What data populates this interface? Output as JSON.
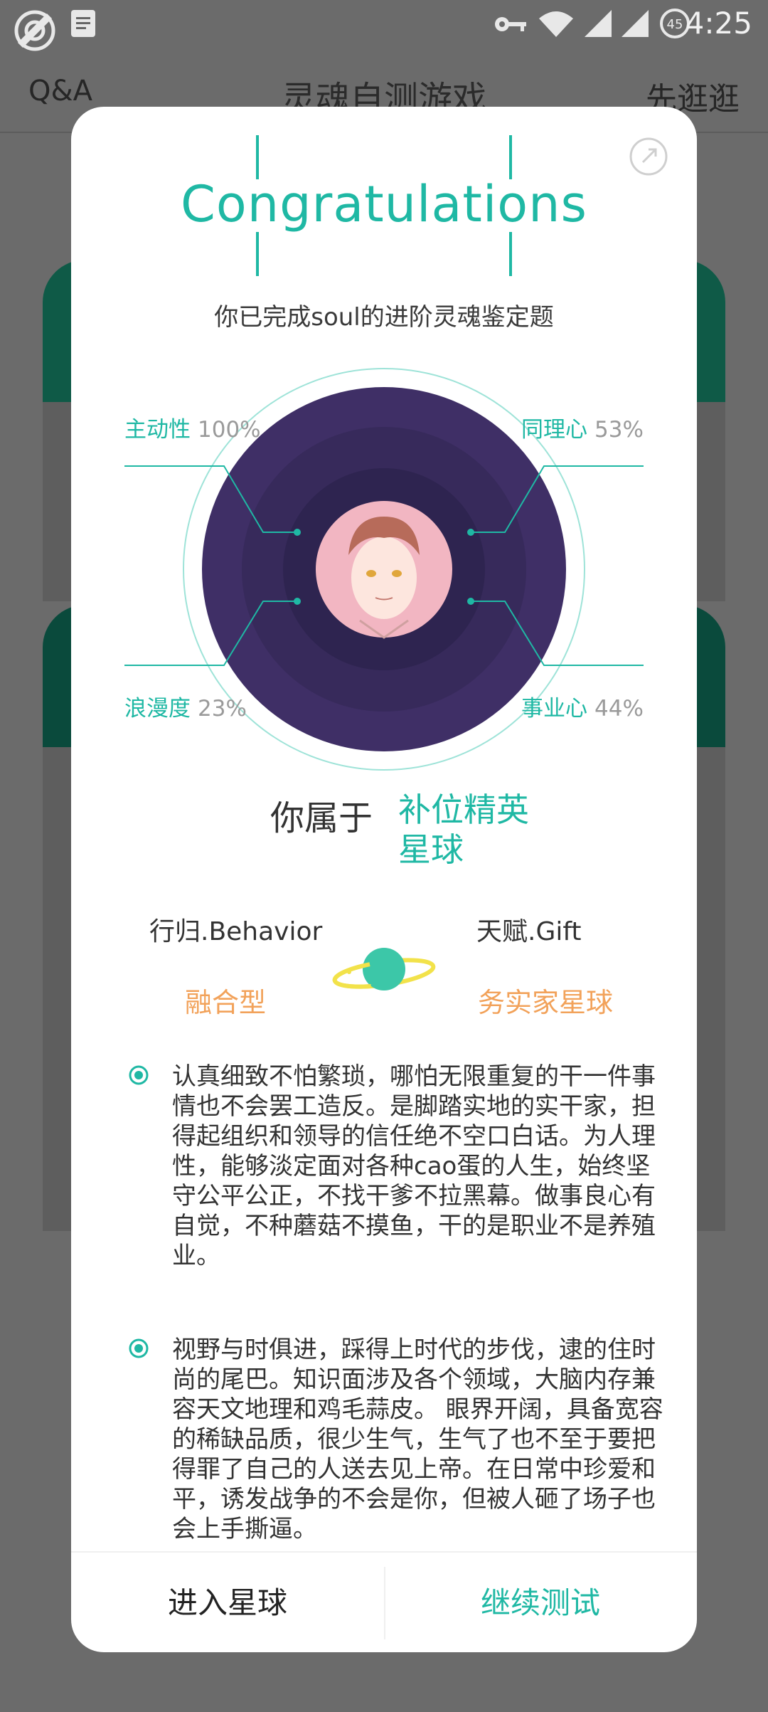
{
  "status_bar": {
    "time": "4:25",
    "battery": "45"
  },
  "nav": {
    "left": "Q&A",
    "title": "灵魂自测游戏",
    "right": "先逛逛"
  },
  "modal": {
    "heading": "Congratulations",
    "subtitle": "你已完成soul的进阶灵魂鉴定题",
    "traits": [
      {
        "label": "主动性",
        "percent": "100%"
      },
      {
        "label": "同理心",
        "percent": "53%"
      },
      {
        "label": "浪漫度",
        "percent": "23%"
      },
      {
        "label": "事业心",
        "percent": "44%"
      }
    ],
    "belong_prefix": "你属于",
    "planet_type": "补位精英星球",
    "behavior_title": "行归.Behavior",
    "behavior_value": "融合型",
    "gift_title": "天赋.Gift",
    "gift_value": "务实家星球",
    "paragraph_1": "认真细致不怕繁琐，哪怕无限重复的干一件事情也不会罢工造反。是脚踏实地的实干家，担得起组织和领导的信任绝不空口白话。为人理性，能够淡定面对各种cao蛋的人生，始终坚守公平公正，不找干爹不拉黑幕。做事良心有自觉，不种蘑菇不摸鱼，干的是职业不是养殖业。",
    "paragraph_2": "视野与时俱进，踩得上时代的步伐，逮的住时尚的尾巴。知识面涉及各个领域，大脑内存兼容天文地理和鸡毛蒜皮。 眼界开阔，具备宽容的稀缺品质，很少生气，生气了也不至于要把得罪了自己的人送去见上帝。在日常中珍爱和平，诱发战争的不会是你，但被人砸了场子也会上手撕逼。",
    "enter_button": "进入星球",
    "continue_button": "继续测试"
  },
  "colors": {
    "accent": "#1fb8a4",
    "orange": "#f2a25a",
    "circle_dark": "#3f2f66"
  }
}
